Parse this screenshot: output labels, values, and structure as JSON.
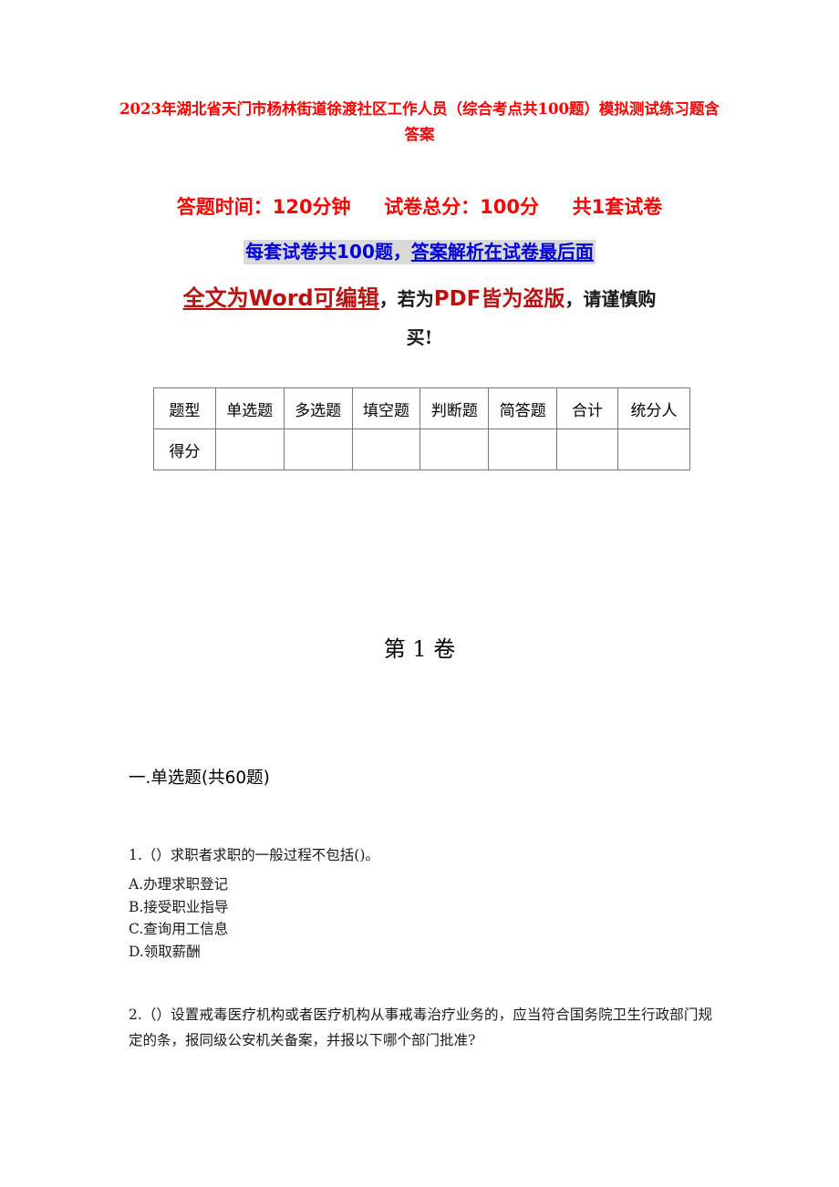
{
  "document": {
    "title": "2023年湖北省天门市杨林街道徐渡社区工作人员（综合考点共100题）模拟测试练习题含答案",
    "exam_info": {
      "duration_label": "答题时间：120分钟",
      "total_score_label": "试卷总分：100分",
      "paper_count_label": "共1套试卷",
      "questions_note_prefix": "每套试卷共100题，",
      "questions_note_underlined": "答案解析在试卷最后面",
      "format_notice_word": "全文为Word可编辑",
      "format_notice_mid": "，若为",
      "format_notice_pdf": "PDF皆为盗版",
      "format_notice_tail": "，请谨慎购",
      "format_notice_last_line": "买!"
    },
    "score_table": {
      "headers": [
        "题型",
        "单选题",
        "多选题",
        "填空题",
        "判断题",
        "简答题",
        "合计",
        "统分人"
      ],
      "rows": [
        {
          "label": "得分",
          "cells": [
            "",
            "",
            "",
            "",
            "",
            "",
            ""
          ]
        }
      ]
    },
    "volume_heading": "第 1 卷",
    "section": {
      "heading": "一.单选题(共60题)"
    },
    "questions": [
      {
        "number": "1.",
        "stem": "1.（）求职者求职的一般过程不包括()。",
        "options": [
          "A.办理求职登记",
          "B.接受职业指导",
          "C.查询用工信息",
          "D.领取薪酬"
        ]
      },
      {
        "number": "2.",
        "stem": "2.（）设置戒毒医疗机构或者医疗机构从事戒毒治疗业务的，应当符合国务院卫生行政部门规定的条，报同级公安机关备案，并报以下哪个部门批准?",
        "options": []
      }
    ]
  },
  "colors": {
    "title_red": "#ff0000",
    "info_red": "#ff0000",
    "info_blue": "#0000dd",
    "notice_dark_red": "#bb1111",
    "highlight_gray": "#d9d9d9",
    "table_border": "#7a7a7a",
    "body_text": "#1a1a1a"
  }
}
